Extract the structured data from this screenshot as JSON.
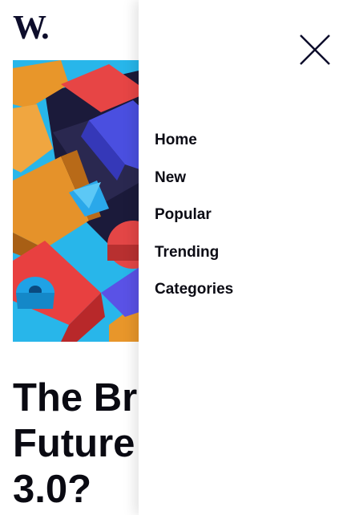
{
  "header": {
    "logo_text": "W."
  },
  "article": {
    "hero_image": "colorful-3d-blocks-illustration",
    "headline_lines": [
      "The Br",
      "Future",
      "3.0?"
    ]
  },
  "menu": {
    "close_icon": "close-icon",
    "items": [
      {
        "label": "Home"
      },
      {
        "label": "New"
      },
      {
        "label": "Popular"
      },
      {
        "label": "Trending"
      },
      {
        "label": "Categories"
      }
    ]
  },
  "colors": {
    "logo": "#0d0d2b",
    "text": "#0b0b14",
    "drawer_bg": "#ffffff"
  }
}
